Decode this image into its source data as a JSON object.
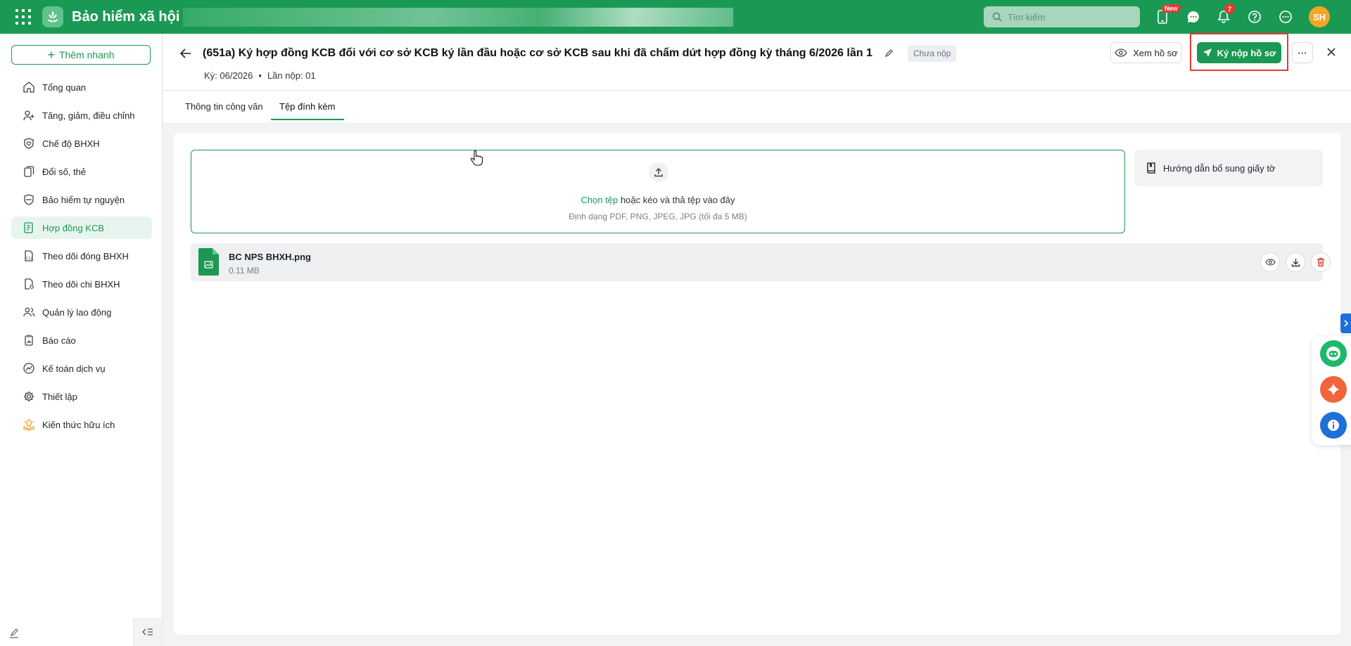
{
  "topbar": {
    "app_title": "Bảo hiểm xã hội",
    "search_placeholder": "Tìm kiếm",
    "phone_badge": "New",
    "notification_count": "7",
    "avatar_initials": "SH",
    "brand_color": "#1a9954"
  },
  "sidebar": {
    "quick_add_label": "Thêm nhanh",
    "items": [
      {
        "label": "Tổng quan",
        "icon": "home-icon"
      },
      {
        "label": "Tăng, giảm, điều chỉnh",
        "icon": "user-adjust-icon"
      },
      {
        "label": "Chế độ BHXH",
        "icon": "shield-heart-icon"
      },
      {
        "label": "Đổi số, thẻ",
        "icon": "card-copy-icon"
      },
      {
        "label": "Bảo hiểm tự nguyện",
        "icon": "shield-check-icon"
      },
      {
        "label": "Hợp đồng KCB",
        "icon": "contract-icon",
        "active": true
      },
      {
        "label": "Theo dõi đóng BHXH",
        "icon": "c12-report-icon"
      },
      {
        "label": "Theo dõi chi BHXH",
        "icon": "doc-search-icon"
      },
      {
        "label": "Quản lý lao động",
        "icon": "users-icon"
      },
      {
        "label": "Báo cáo",
        "icon": "clipboard-chart-icon"
      },
      {
        "label": "Kế toán dịch vụ",
        "icon": "gauge-icon"
      },
      {
        "label": "Thiết lập",
        "icon": "gear-icon"
      },
      {
        "label": "Kiến thức hữu ích",
        "icon": "lightbulb-book-icon"
      }
    ]
  },
  "header": {
    "title": "(651a) Ký hợp đồng KCB đối với cơ sở KCB ký lần đầu hoặc cơ sở KCB sau khi đã chấm dứt hợp đồng kỳ tháng 6/2026 lần 1",
    "status": "Chưa nộp",
    "period": "Kỳ: 06/2026",
    "dot": "•",
    "submission": "Lần nộp: 01",
    "view_button": "Xem hồ sơ",
    "sign_button": "Ký nộp hồ sơ",
    "more_button": "···"
  },
  "tabs": [
    {
      "label": "Thông tin công văn",
      "active": false
    },
    {
      "label": "Tệp đính kèm",
      "active": true
    }
  ],
  "upload": {
    "choose_link": "Chọn tệp",
    "instruction": " hoặc kéo và thả tệp vào đây",
    "formats": "Định dạng PDF, PNG, JPEG, JPG (tối đa 5 MB)"
  },
  "guide": {
    "label": "Hướng dẫn bổ sung giấy tờ"
  },
  "files": [
    {
      "name": "BC NPS BHXH.png",
      "size": "0.11 MB"
    }
  ]
}
